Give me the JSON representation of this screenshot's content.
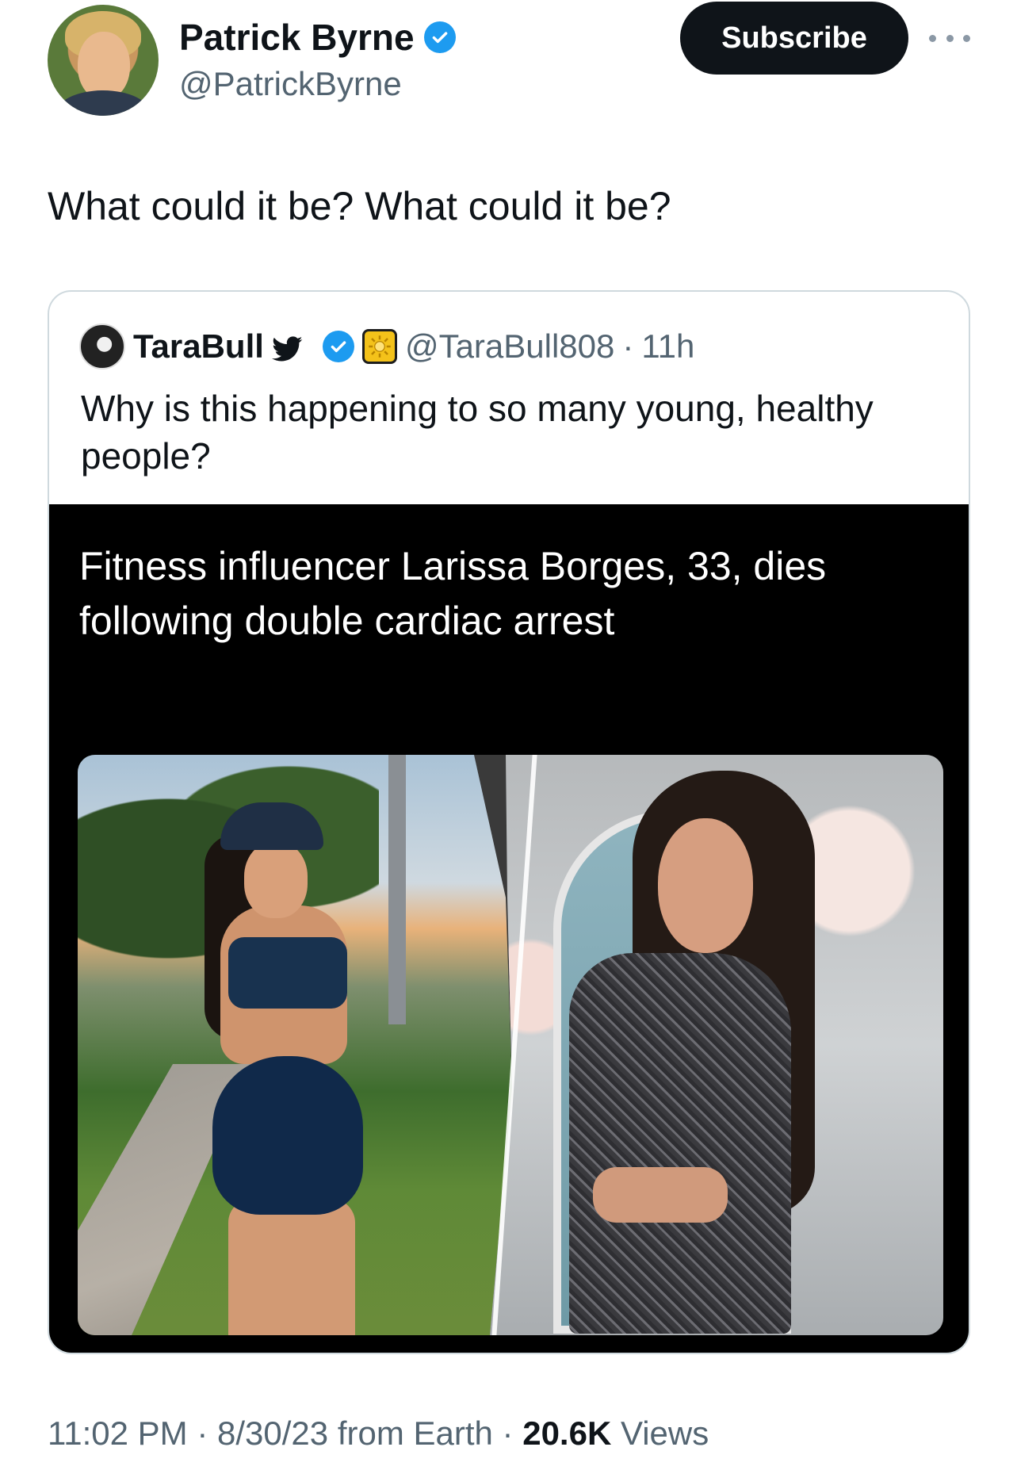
{
  "author": {
    "display_name": "Patrick Byrne",
    "handle": "@PatrickByrne",
    "avatar_icon": "profile-photo"
  },
  "actions": {
    "subscribe_label": "Subscribe",
    "more_icon": "more-horizontal-icon"
  },
  "tweet": {
    "text": "What could it be? What could it be?"
  },
  "quote": {
    "display_name": "TaraBull",
    "handle": "@TaraBull808",
    "separator": "·",
    "time": "11h",
    "text": "Why is this happening to so many young, healthy people?",
    "media": {
      "headline": "Fitness influencer Larissa Borges, 33, dies following double cardiac arrest"
    }
  },
  "meta": {
    "time": "11:02 PM",
    "sep1": "·",
    "date": "8/30/23",
    "source": "from Earth",
    "sep2": "·",
    "views_count": "20.6K",
    "views_label": "Views"
  },
  "colors": {
    "accent": "#1d9bf0",
    "text": "#0f1419",
    "muted": "#536471",
    "button_bg": "#0f1419"
  }
}
